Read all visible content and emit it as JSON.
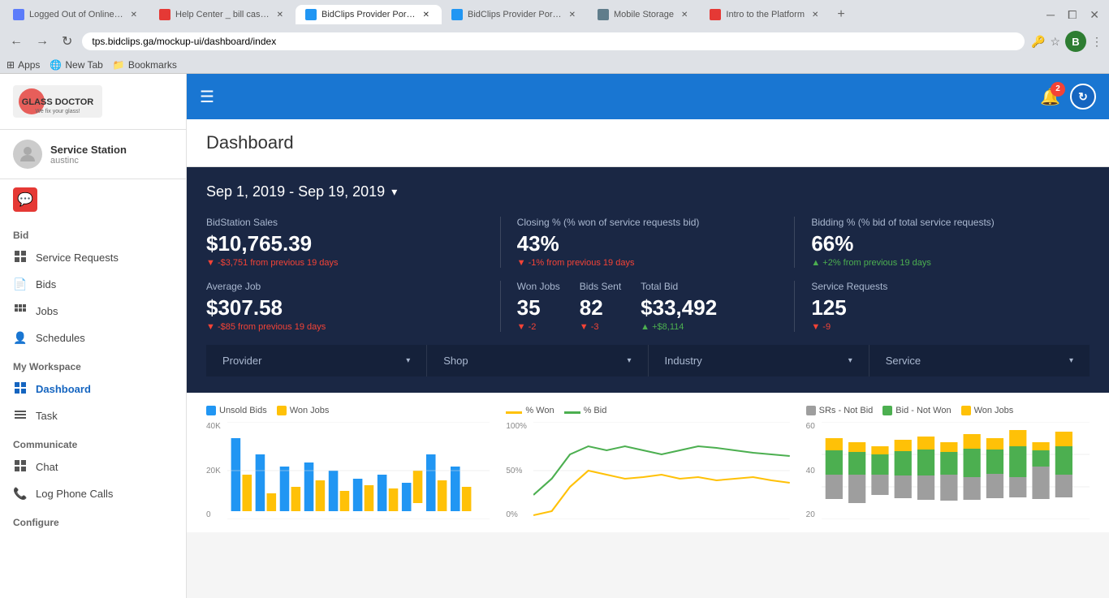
{
  "browser": {
    "tabs": [
      {
        "id": "tab1",
        "label": "Logged Out of Online ...",
        "favicon_color": "#5c7cfa",
        "active": false
      },
      {
        "id": "tab2",
        "label": "Help Center _ bill casey",
        "favicon_color": "#e53935",
        "active": false
      },
      {
        "id": "tab3",
        "label": "BidClips Provider Portal",
        "favicon_color": "#2196f3",
        "active": true
      },
      {
        "id": "tab4",
        "label": "BidClips Provider Portal",
        "favicon_color": "#2196f3",
        "active": false
      },
      {
        "id": "tab5",
        "label": "Mobile Storage",
        "favicon_color": "#607d8b",
        "active": false
      },
      {
        "id": "tab6",
        "label": "Intro to the Platform",
        "favicon_color": "#e53935",
        "active": false
      }
    ],
    "url": "tps.bidclips.ga/mockup-ui/dashboard/index",
    "bookmarks": [
      {
        "label": "Apps"
      },
      {
        "label": "New Tab"
      },
      {
        "label": "Bookmarks"
      }
    ]
  },
  "sidebar": {
    "logo_alt": "Glass Doctor",
    "user": {
      "name": "Service Station",
      "sub": "austinc"
    },
    "sections": [
      {
        "label": "Bid",
        "items": [
          {
            "id": "service-requests",
            "label": "Service Requests",
            "icon": "grid"
          },
          {
            "id": "bids",
            "label": "Bids",
            "icon": "doc"
          },
          {
            "id": "jobs",
            "label": "Jobs",
            "icon": "grid4"
          },
          {
            "id": "schedules",
            "label": "Schedules",
            "icon": "person"
          }
        ]
      },
      {
        "label": "My Workspace",
        "items": [
          {
            "id": "dashboard",
            "label": "Dashboard",
            "icon": "squares",
            "active": true
          },
          {
            "id": "task",
            "label": "Task",
            "icon": "lines"
          }
        ]
      },
      {
        "label": "Communicate",
        "items": [
          {
            "id": "chat",
            "label": "Chat",
            "icon": "grid"
          },
          {
            "id": "log-phone-calls",
            "label": "Log Phone Calls",
            "icon": "phone"
          }
        ]
      },
      {
        "label": "Configure",
        "items": []
      }
    ]
  },
  "topnav": {
    "notif_count": "2"
  },
  "dashboard": {
    "title": "Dashboard",
    "date_range": "Sep 1, 2019 - Sep 19, 2019",
    "stats": {
      "bidstation_sales": {
        "label": "BidStation Sales",
        "value": "$10,765.39",
        "change": "-$3,751 from previous 19 days",
        "change_type": "negative"
      },
      "closing_pct": {
        "label": "Closing % (% won of service requests bid)",
        "value": "43%",
        "change": "-1% from previous 19 days",
        "change_type": "negative"
      },
      "bidding_pct": {
        "label": "Bidding % (% bid of total service requests)",
        "value": "66%",
        "change": "+2% from previous 19 days",
        "change_type": "positive"
      },
      "avg_job": {
        "label": "Average Job",
        "value": "$307.58",
        "change": "-$85 from previous 19 days",
        "change_type": "negative"
      },
      "won_jobs": {
        "label": "Won Jobs",
        "value": "35",
        "change": "-2",
        "change_type": "negative"
      },
      "bids_sent": {
        "label": "Bids Sent",
        "value": "82",
        "change": "-3",
        "change_type": "negative"
      },
      "total_bid": {
        "label": "Total Bid",
        "value": "$33,492",
        "change": "+$8,114",
        "change_type": "positive"
      },
      "service_requests": {
        "label": "Service Requests",
        "value": "125",
        "change": "-9",
        "change_type": "negative"
      }
    },
    "filters": [
      {
        "label": "Provider"
      },
      {
        "label": "Shop"
      },
      {
        "label": "Industry"
      },
      {
        "label": "Service"
      }
    ],
    "charts": [
      {
        "legend": [
          {
            "label": "Unsold Bids",
            "color": "#2196f3"
          },
          {
            "label": "Won Jobs",
            "color": "#ffc107"
          }
        ],
        "y_max": "40K",
        "y_mid": "20K",
        "y_min": "0",
        "type": "bar"
      },
      {
        "legend": [
          {
            "label": "% Won",
            "color": "#ffc107"
          },
          {
            "label": "% Bid",
            "color": "#4caf50"
          }
        ],
        "y_max": "100%",
        "y_mid": "50%",
        "y_min": "0%",
        "type": "line"
      },
      {
        "legend": [
          {
            "label": "SRs - Not Bid",
            "color": "#9e9e9e"
          },
          {
            "label": "Bid - Not Won",
            "color": "#4caf50"
          },
          {
            "label": "Won Jobs",
            "color": "#ffc107"
          }
        ],
        "y_max": "60",
        "y_mid": "40",
        "y_min": "20",
        "type": "bar-stacked"
      }
    ]
  }
}
